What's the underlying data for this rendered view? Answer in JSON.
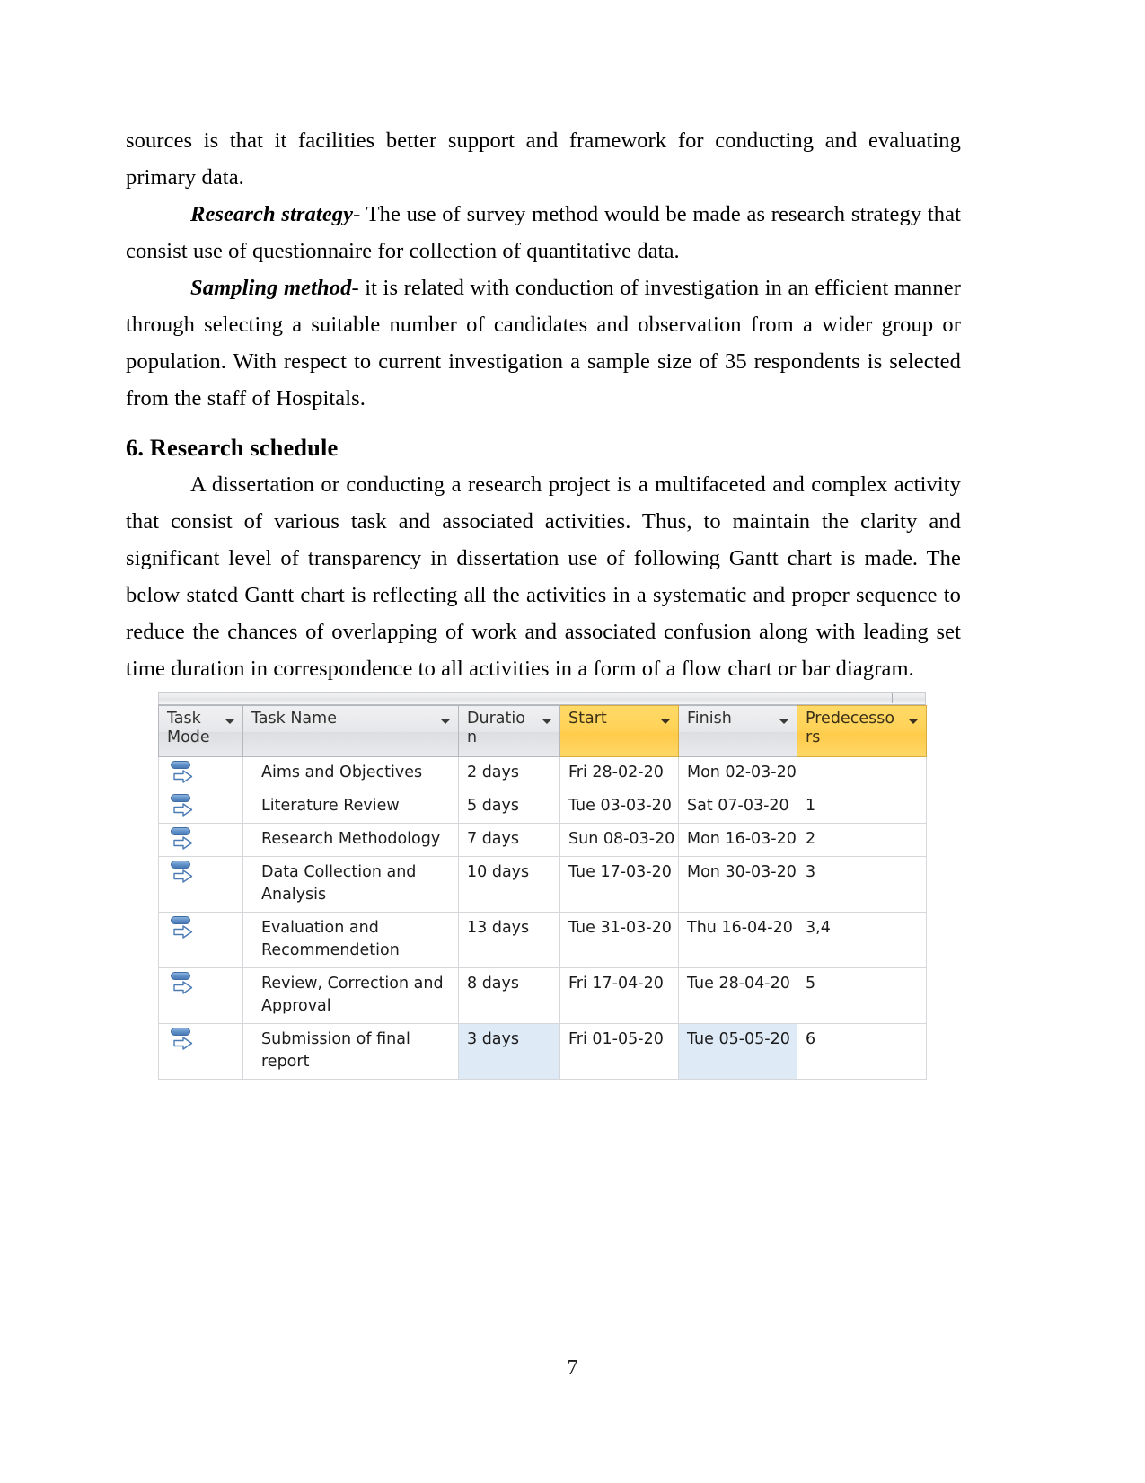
{
  "document": {
    "page_number": "7",
    "paragraphs": [
      {
        "id": "p1",
        "text": "sources is that it facilities better support and framework for conducting and evaluating primary data.",
        "indent": false
      },
      {
        "id": "p2",
        "lead": "Research strategy",
        "text": "- The use of survey method would be made as research strategy that consist use of questionnaire for collection of quantitative data.",
        "indent": true
      },
      {
        "id": "p3",
        "lead": "Sampling method",
        "text": "- it is related with conduction of investigation in an efficient manner through selecting a suitable number of candidates and observation from a wider group or population. With respect to current investigation a sample size of 35 respondents is selected from the staff of Hospitals.",
        "indent": true
      }
    ],
    "heading": "6. Research schedule",
    "paragraph_after_heading": "A dissertation or conducting a research project is a multifaceted and complex activity that consist of various task and associated activities. Thus, to maintain the clarity and significant level of transparency in dissertation use of following Gantt chart is made. The below stated Gantt chart is reflecting all the activities in a systematic and proper sequence to reduce the chances of overlapping of work and associated confusion along with leading set time duration in correspondence to all activities in a form of a flow chart or bar diagram."
  },
  "colors": {
    "header_highlight": "#ffd257",
    "header_default": "#e6e7ea",
    "selection": "#dfeaf7",
    "grid_line": "#d5d7da",
    "task_mode_icon": "#5d8ec8"
  },
  "project_table": {
    "columns": [
      {
        "key": "task_mode",
        "label": "Task Mode",
        "highlight": false,
        "filter": true
      },
      {
        "key": "task_name",
        "label": "Task Name",
        "highlight": false,
        "filter": true
      },
      {
        "key": "duration",
        "label": "Duration",
        "highlight": false,
        "filter": true
      },
      {
        "key": "start",
        "label": "Start",
        "highlight": true,
        "filter": true
      },
      {
        "key": "finish",
        "label": "Finish",
        "highlight": false,
        "filter": true
      },
      {
        "key": "predecessors",
        "label": "Predecessors",
        "highlight": true,
        "filter": true
      }
    ],
    "rows": [
      {
        "task_mode_icon": "auto-scheduled-icon",
        "task_name": "Aims and Objectives",
        "duration": "2 days",
        "start": "Fri 28-02-20",
        "finish": "Mon 02-03-20",
        "predecessors": "",
        "selected": false
      },
      {
        "task_mode_icon": "auto-scheduled-icon",
        "task_name": "Literature Review",
        "duration": "5 days",
        "start": "Tue 03-03-20",
        "finish": "Sat 07-03-20",
        "predecessors": "1",
        "selected": false
      },
      {
        "task_mode_icon": "auto-scheduled-icon",
        "task_name": "Research Methodology",
        "duration": "7 days",
        "start": "Sun 08-03-20",
        "finish": "Mon 16-03-20",
        "predecessors": "2",
        "selected": false
      },
      {
        "task_mode_icon": "auto-scheduled-icon",
        "task_name": "Data Collection and Analysis",
        "duration": "10 days",
        "start": "Tue 17-03-20",
        "finish": "Mon 30-03-20",
        "predecessors": "3",
        "selected": false
      },
      {
        "task_mode_icon": "auto-scheduled-icon",
        "task_name": "Evaluation and Recommendetion",
        "duration": "13 days",
        "start": "Tue 31-03-20",
        "finish": "Thu 16-04-20",
        "predecessors": "3,4",
        "selected": false
      },
      {
        "task_mode_icon": "auto-scheduled-icon",
        "task_name": "Review, Correction and Approval",
        "duration": "8 days",
        "start": "Fri 17-04-20",
        "finish": "Tue 28-04-20",
        "predecessors": "5",
        "selected": false
      },
      {
        "task_mode_icon": "auto-scheduled-icon",
        "task_name": "Submission of final report",
        "duration": "3 days",
        "start": "Fri 01-05-20",
        "finish": "Tue 05-05-20",
        "predecessors": "6",
        "selected": true,
        "selected_cells": [
          "duration",
          "finish"
        ]
      }
    ]
  }
}
